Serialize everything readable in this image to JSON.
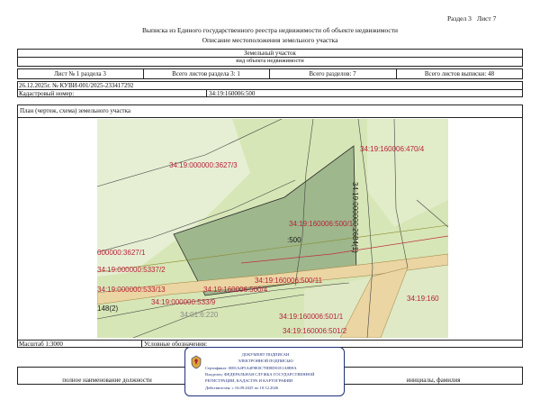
{
  "header": {
    "section": "Раздел 3",
    "sheet": "Лист 7",
    "title": "Выписка из Единого государственного реестра недвижимости об объекте недвижимости",
    "subtitle": "Описание местоположения земельного участка"
  },
  "object": {
    "type": "Земельный участок",
    "kind_caption": "вид объекта недвижимости"
  },
  "sheet_info": {
    "sheet_of_section": "Лист № 1 раздела 3",
    "sheets_in_section": "Всего листов раздела 3: 1",
    "sections_total": "Всего разделов: 7",
    "sheets_total": "Всего листов выписки: 48"
  },
  "doc": {
    "date_number": "26.12.2025г. № КУВИ-001/2025-233417292",
    "cadastral_label": "Кадастровый номер:",
    "cadastral_number": "34:19:160006:500"
  },
  "plan": {
    "caption": "План (чертеж, схема) земельного участка",
    "labels": [
      "34:19:000000:3627/3",
      "34:19:160006:470/4",
      "34:19:160006:500/1",
      ":500",
      "34:19:000000:2684(1)",
      "000000:3627/1",
      "34:19:000000:5337/2",
      "34:19:000000:533/13",
      "34:19:160006:500/4",
      "34:19:000000:533/9",
      "34:19:160006:500/11",
      "148(2)",
      "34:01:6:220",
      "34:19:160006:501/1",
      "34:19:160006:501/2",
      "34:19:160"
    ]
  },
  "footer": {
    "scale": "Масштаб 1:3000",
    "legend": "Условные обозначения:",
    "position_caption": "полное наименование должности",
    "name_caption": "инициалы, фамилия"
  },
  "stamp": {
    "line1": "ДОКУМЕНТ ПОДПИСАН",
    "line2": "ЭЛЕКТРОННОЙ ПОДПИСЬЮ",
    "line3": "Сертификат: 0081A4F5A4F8E0C78D8D01E1A8B9A",
    "line4": "Владелец: ФЕДЕРАЛЬНАЯ СЛУЖБА ГОСУДАРСТВЕННОЙ",
    "line5": "РЕГИСТРАЦИИ, КАДАСТРА И КАРТОГРАФИИ",
    "line6": "Действителен: с 16.09.2025 по 10.12.2026"
  },
  "colors": {
    "map_background": "#d7e6b6",
    "map_light": "#e6efd3",
    "parcel_fill": "#9eb78c",
    "road_fill": "#ead5a3",
    "label_red": "#b8213a",
    "stamp_blue": "#1f2f7a"
  }
}
